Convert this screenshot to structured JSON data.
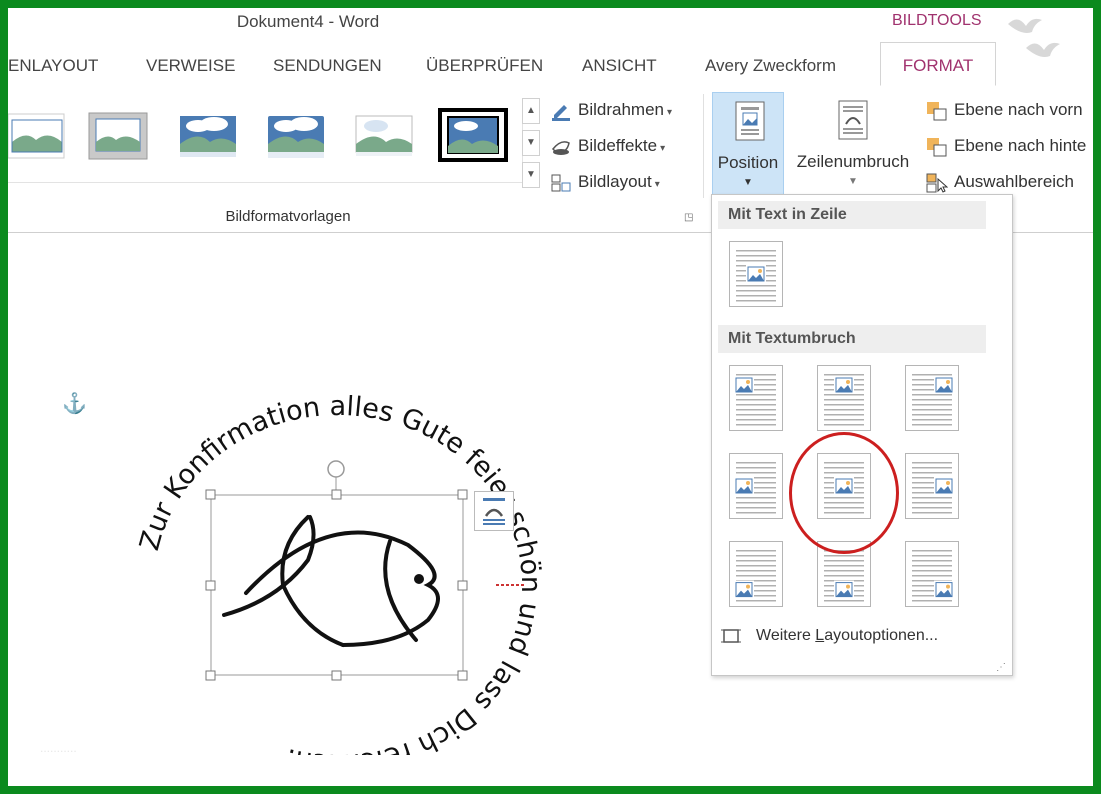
{
  "window": {
    "title": "Dokument4 - Word",
    "contextual_tab_group": "BILDTOOLS"
  },
  "tabs": [
    {
      "label": "ENLAYOUT"
    },
    {
      "label": "VERWEISE"
    },
    {
      "label": "SENDUNGEN"
    },
    {
      "label": "ÜBERPRÜFEN"
    },
    {
      "label": "ANSICHT"
    },
    {
      "label": "Avery Zweckform"
    },
    {
      "label": "FORMAT",
      "active": true
    }
  ],
  "ribbon": {
    "picture_styles_group_label": "Bildformatvorlagen",
    "commands": {
      "border": "Bildrahmen",
      "effects": "Bildeffekte",
      "layout": "Bildlayout",
      "position": "Position",
      "wrap_text": "Zeilenumbruch",
      "bring_forward": "Ebene nach vorn",
      "send_backward": "Ebene nach hinte",
      "selection_pane": "Auswahlbereich"
    }
  },
  "document": {
    "circular_text": "Zur Konfirmation alles Gute feier schön und lass Dich reichlich.",
    "circular_text_misspelled_word": "feier",
    "watermark": "..........."
  },
  "position_dropdown": {
    "section_inline": "Mit Text in Zeile",
    "section_wrap": "Mit Textumbruch",
    "selected_option": "middle-center",
    "more_options": "Weitere Layoutoptionen...",
    "more_options_access_key": "L"
  },
  "colors": {
    "frame": "#0b8a1e",
    "accent_tab": "#a0326e",
    "highlight": "#cc1f1f",
    "selected_button_bg": "#cde4f7"
  }
}
